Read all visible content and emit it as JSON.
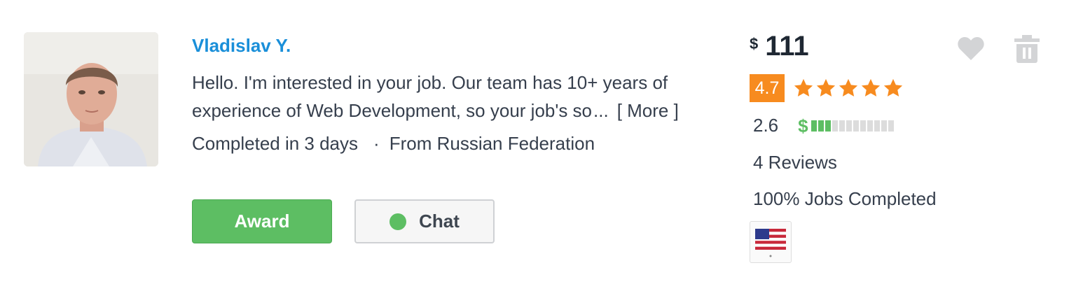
{
  "freelancer": {
    "name": "Vladislav Y.",
    "description_line1": "Hello. I'm interested in your job. Our team has 10+ years of",
    "description_line2": "experience of Web Development, so your job's so",
    "ellipsis": "...",
    "more_label": "[ More ]",
    "completion": "Completed in 3 days",
    "separator": "·",
    "location": "From Russian Federation"
  },
  "actions": {
    "award_label": "Award",
    "chat_label": "Chat",
    "online_color": "#5dbe63"
  },
  "bid": {
    "currency": "$",
    "amount": "111"
  },
  "stats": {
    "rating": "4.7",
    "stars": 5,
    "earnings_score": "2.6",
    "earnings_bars_filled": 3,
    "earnings_bars_total": 12,
    "reviews": "4 Reviews",
    "jobs_completed": "100% Jobs Completed"
  },
  "icons": {
    "favorite": "heart-icon",
    "delete": "trash-icon",
    "flag": "us-flag-icon",
    "star": "star-icon",
    "dollar": "dollar-icon"
  },
  "colors": {
    "link": "#1a8fd9",
    "award_bg": "#5dbe63",
    "rating_badge": "#f78b1f",
    "star": "#f78b1f"
  }
}
